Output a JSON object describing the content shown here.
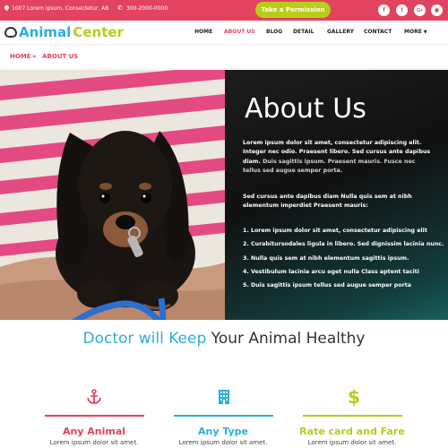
{
  "topbar": {
    "address": "1007 Lorem ipsum, Consectetur, AB",
    "phone": "300-2000-0000",
    "permission_button": "Take a Permission",
    "social": {
      "facebook": "f",
      "twitter": "t",
      "google": "G+",
      "rss": "◉"
    }
  },
  "brand": {
    "word1": "Animal",
    "word2": "Center"
  },
  "nav": {
    "items": [
      "HOME",
      "ABOUT US",
      "BLOG",
      "DETAIL",
      "GALLERY",
      "CONTACT",
      "MORE"
    ],
    "active": "ABOUT US"
  },
  "breadcrumb": {
    "home": "HOME",
    "separator": "»",
    "current": "ABOUT US"
  },
  "about": {
    "title": "About Us",
    "para1_main": "Lorem ipsum dolor sit amet, consectetur adipiscing elit. Integer nec odio. Praesent libero. Sed cursus ante dapibus diam.",
    "para1_muted": "Duis sagittis ipsum. Praesent mauris. Fusce nec tellus sed augue semper porta.",
    "para2": "Sed cursus ante dapibus diam Nulla quis sem at nibh elementum imperdiet Praesent mauris:",
    "list": [
      "1. Lorem ipsum dolor sit amet, consectetur adipiscing elit",
      "2. Curabitursodales ligula in libero. Sed dignissim lacinia nunc.",
      "3. Nulla quis sem at nibh elementum sagittis ipsum.",
      "4. Vestibulum lacinia arcu eget nulla Class aptent taciti",
      "5. Duis sagittis ipsum tellus sed augue semper porta"
    ]
  },
  "section": {
    "title_blue": "Doctor will Keep",
    "title_dark": "Your Animal Healthy"
  },
  "cards": [
    {
      "title": "Any Animal",
      "text": "Lorem ipsum dolor sit amet.",
      "icon": "anchor-icon",
      "color": "#e2435f"
    },
    {
      "title": "Any Type",
      "text": "Lorem ipsum dolor sit amet.",
      "icon": "building-icon",
      "color": "#2cadde"
    },
    {
      "title": "Rate card and Fare",
      "text": "Lorem ipsum dolor sit amet.",
      "icon": "dollar-icon",
      "color": "#b8cc19"
    }
  ],
  "colors": {
    "accent": "#e2435f",
    "blue": "#2cadde",
    "green": "#b8cc19"
  }
}
